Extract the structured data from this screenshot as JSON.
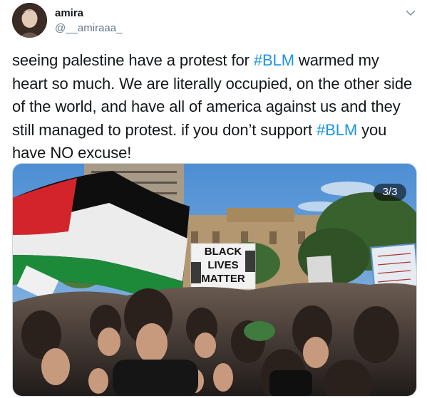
{
  "user": {
    "name": "amira",
    "handle": "@__amiraaa_"
  },
  "tweet": {
    "segments": [
      {
        "text": "seeing palestine have a protest for ",
        "type": "text"
      },
      {
        "text": "#BLM",
        "type": "hashtag"
      },
      {
        "text": " warmed my heart so much. We are literally occupied, on the other side of the world, and have all of america against us and they still managed to protest. if you don’t support ",
        "type": "text"
      },
      {
        "text": "#BLM",
        "type": "hashtag"
      },
      {
        "text": " you have NO excuse!",
        "type": "text"
      }
    ]
  },
  "media": {
    "counter": "3/3",
    "sign_text": [
      "BLACK",
      "LIVES",
      "MATTER"
    ]
  },
  "colors": {
    "hashtag": "#1b95e0",
    "secondary_text": "#657786"
  },
  "icons": {
    "more": "chevron-down-icon"
  }
}
